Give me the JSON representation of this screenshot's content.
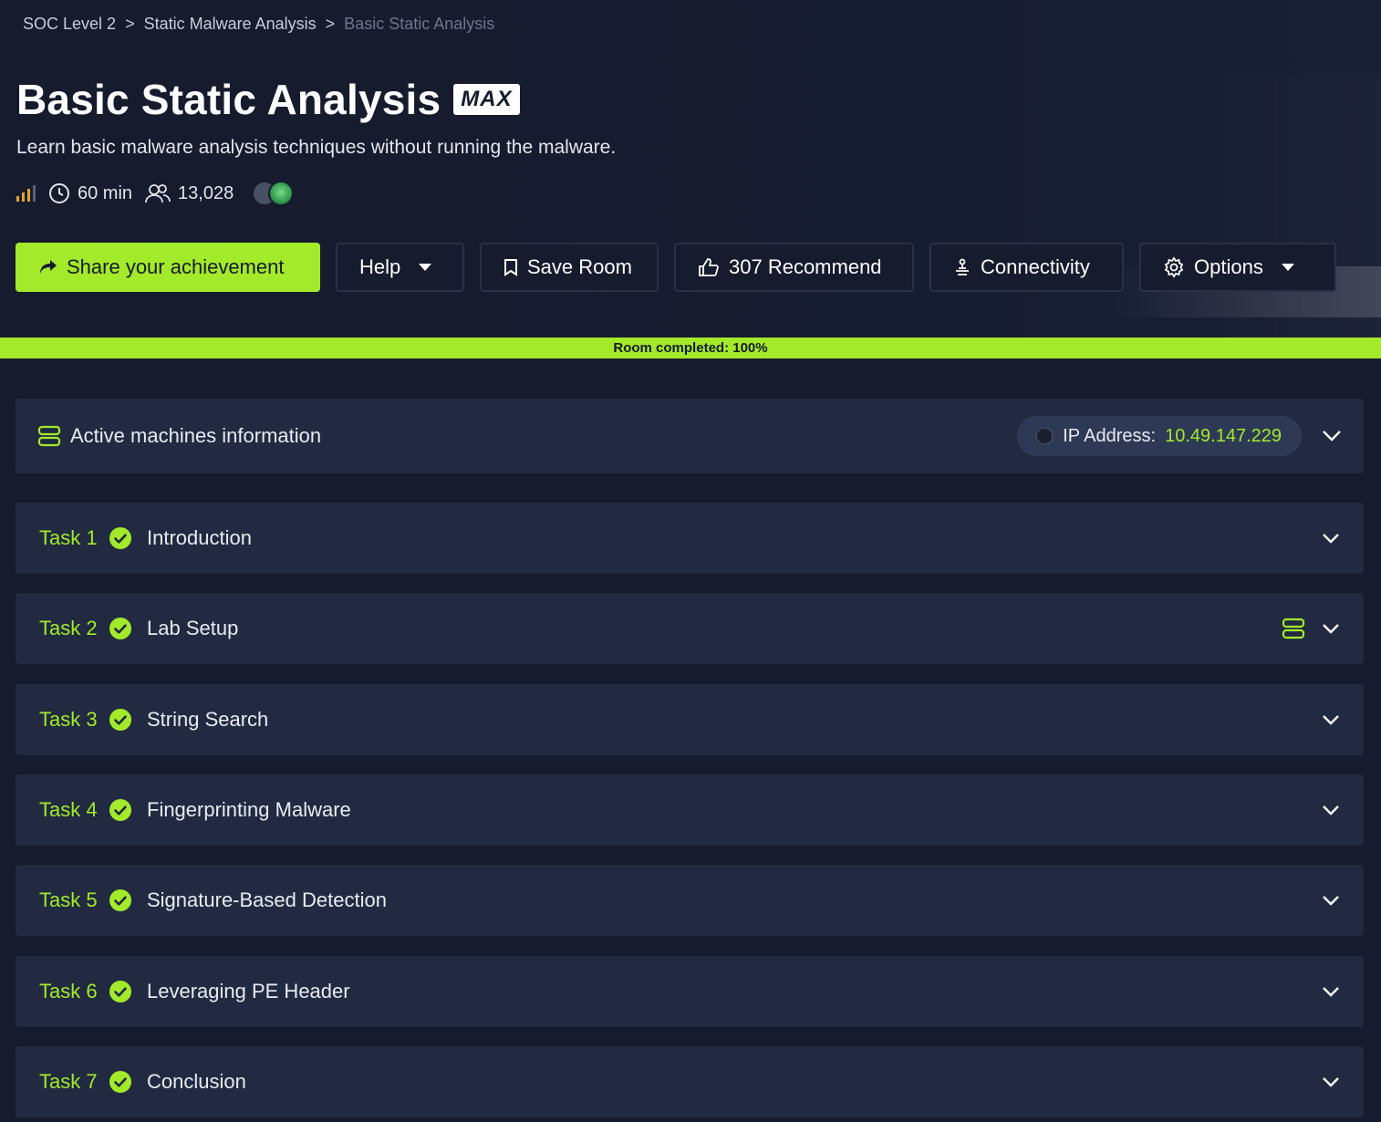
{
  "breadcrumb": [
    "SOC Level 2",
    "Static Malware Analysis",
    "Basic Static Analysis"
  ],
  "breadcrumb_separator": ">",
  "room": {
    "title": "Basic Static Analysis",
    "badge": "MAX",
    "subtitle": "Learn basic malware analysis techniques without running the malware.",
    "duration": "60 min",
    "users": "13,028",
    "difficulty_icon": "signal-bars-icon"
  },
  "actions": {
    "share": "Share your achievement",
    "help": "Help",
    "save": "Save Room",
    "recommend": "307 Recommend",
    "connectivity": "Connectivity",
    "options": "Options"
  },
  "progress": {
    "label": "Room completed: 100%",
    "percent": 100
  },
  "machines": {
    "label": "Active machines information",
    "ip_label": "IP Address:",
    "ip_value": "10.49.147.229"
  },
  "tasks": [
    {
      "number": "Task 1",
      "title": "Introduction",
      "has_machine": false
    },
    {
      "number": "Task 2",
      "title": "Lab Setup",
      "has_machine": true
    },
    {
      "number": "Task 3",
      "title": "String Search",
      "has_machine": false
    },
    {
      "number": "Task 4",
      "title": "Fingerprinting Malware",
      "has_machine": false
    },
    {
      "number": "Task 5",
      "title": "Signature-Based Detection",
      "has_machine": false
    },
    {
      "number": "Task 6",
      "title": "Leveraging PE Header",
      "has_machine": false
    },
    {
      "number": "Task 7",
      "title": "Conclusion",
      "has_machine": false
    }
  ],
  "colors": {
    "accent": "#a3ea2a",
    "background": "#161b2d",
    "card": "#212a40"
  }
}
